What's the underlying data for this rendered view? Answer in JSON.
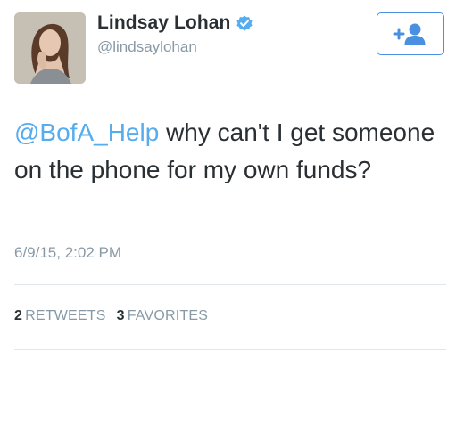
{
  "user": {
    "display_name": "Lindsay Lohan",
    "handle": "@lindsaylohan"
  },
  "icons": {
    "verified": "verified-badge-icon",
    "follow": "add-user-icon",
    "avatar": "profile-photo"
  },
  "colors": {
    "mention": "#55acee",
    "verified": "#55acee",
    "button_border": "#4a90e2",
    "text": "#292f33",
    "muted": "#8899a6"
  },
  "tweet": {
    "mention": "@BofA_Help",
    "text": " why can't I get someone on the phone for my own funds?",
    "timestamp": "6/9/15, 2:02 PM"
  },
  "stats": {
    "retweets_count": "2",
    "retweets_label": "RETWEETS",
    "favorites_count": "3",
    "favorites_label": "FAVORITES"
  }
}
